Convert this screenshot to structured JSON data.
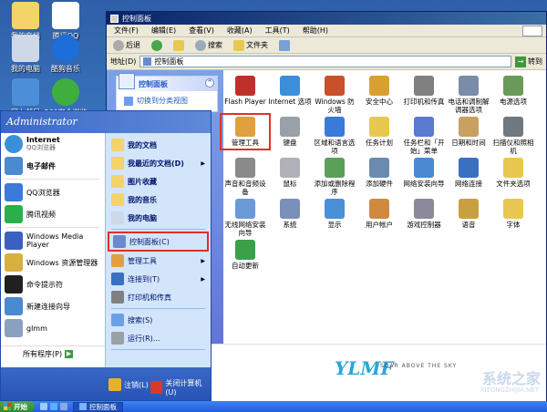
{
  "desktop": {
    "icons": [
      {
        "label": "我的文档",
        "color": "#f3d36a"
      },
      {
        "label": "腾讯QQ",
        "color": "#ffffff"
      },
      {
        "label": "我的电脑",
        "color": "#cfd8e8"
      },
      {
        "label": "酷狗音乐",
        "color": "#1d6ed8"
      },
      {
        "label": "网上邻居",
        "color": "#4c8ed8"
      },
      {
        "label": "360安全浏览",
        "color": "#3fae3f"
      }
    ]
  },
  "window": {
    "title": "控制面板",
    "menu": [
      "文件(F)",
      "编辑(E)",
      "查看(V)",
      "收藏(A)",
      "工具(T)",
      "帮助(H)"
    ],
    "toolbar": {
      "back": "后退",
      "search": "搜索",
      "folders": "文件夹"
    },
    "address": {
      "label": "地址(D)",
      "value": "控制面板",
      "go": "转到"
    },
    "task_panel": {
      "title": "控制面板",
      "link": "切换到分类视图"
    },
    "items": [
      {
        "label": "Flash Player",
        "color": "#c0302a"
      },
      {
        "label": "Internet 选项",
        "color": "#3a8fd8"
      },
      {
        "label": "Windows 防火墙",
        "color": "#c8502a"
      },
      {
        "label": "安全中心",
        "color": "#d8a030"
      },
      {
        "label": "打印机和传真",
        "color": "#808080"
      },
      {
        "label": "电话和调制解调器选项",
        "color": "#7a8da8"
      },
      {
        "label": "电源选项",
        "color": "#6a9a5a"
      },
      {
        "label": "管理工具",
        "color": "#e0a040"
      },
      {
        "label": "键盘",
        "color": "#9aa0a8"
      },
      {
        "label": "区域和语言选项",
        "color": "#3a7ad8"
      },
      {
        "label": "任务计划",
        "color": "#e8c850"
      },
      {
        "label": "任务栏和「开始」菜单",
        "color": "#5a7ad0"
      },
      {
        "label": "日期和时间",
        "color": "#c8a060"
      },
      {
        "label": "扫描仪和照相机",
        "color": "#707880"
      },
      {
        "label": "声音和音频设备",
        "color": "#8a8a8a"
      },
      {
        "label": "鼠标",
        "color": "#b0b0b8"
      },
      {
        "label": "添加或删除程序",
        "color": "#5aa05a"
      },
      {
        "label": "添加硬件",
        "color": "#6a8ab0"
      },
      {
        "label": "网络安装向导",
        "color": "#4a8ad0"
      },
      {
        "label": "网络连接",
        "color": "#3a70c0"
      },
      {
        "label": "文件夹选项",
        "color": "#e8c850"
      },
      {
        "label": "无线网络安装向导",
        "color": "#6a9ad8"
      },
      {
        "label": "系统",
        "color": "#7a90b8"
      },
      {
        "label": "显示",
        "color": "#4a90d8"
      },
      {
        "label": "用户帐户",
        "color": "#d08a40"
      },
      {
        "label": "游戏控制器",
        "color": "#8a8a9a"
      },
      {
        "label": "语音",
        "color": "#c8a040"
      },
      {
        "label": "字体",
        "color": "#e8c850"
      },
      {
        "label": "自动更新",
        "color": "#3aa04a"
      }
    ],
    "banner": {
      "logo": "YLMF",
      "tagline": "SOAR ABOVE THE SKY",
      "watermark": "系统之家",
      "watermark_url": "XITONGZHIJIA.NET"
    }
  },
  "start_menu": {
    "user": "Administrator",
    "left_pinned": [
      {
        "title": "Internet",
        "sub": "QQ浏览器",
        "color": "#3a8fd8"
      },
      {
        "title": "电子邮件",
        "sub": "",
        "color": "#4a8ad0"
      }
    ],
    "left_recent": [
      {
        "title": "QQ浏览器",
        "color": "#3a7ad8"
      },
      {
        "title": "腾讯视频",
        "color": "#2ab04a"
      },
      {
        "title": "Windows Media Player",
        "color": "#3a60c0"
      },
      {
        "title": "Windows 资源管理器",
        "color": "#d8b040"
      },
      {
        "title": "命令提示符",
        "color": "#202020"
      },
      {
        "title": "新建连接向导",
        "color": "#4a8ad0"
      },
      {
        "title": "glmm",
        "color": "#8aa0c0"
      }
    ],
    "all_programs": "所有程序(P)",
    "right": [
      {
        "label": "我的文档",
        "bold": true,
        "arrow": false,
        "color": "#f3d36a"
      },
      {
        "label": "我最近的文档(D)",
        "bold": true,
        "arrow": true,
        "color": "#f3d36a"
      },
      {
        "label": "图片收藏",
        "bold": true,
        "arrow": false,
        "color": "#f3d36a"
      },
      {
        "label": "我的音乐",
        "bold": true,
        "arrow": false,
        "color": "#f3d36a"
      },
      {
        "label": "我的电脑",
        "bold": true,
        "arrow": false,
        "color": "#cfd8e8"
      }
    ],
    "right2": [
      {
        "label": "控制面板(C)",
        "highlight": true,
        "arrow": false,
        "color": "#6a8ad0"
      },
      {
        "label": "管理工具",
        "highlight": false,
        "arrow": true,
        "color": "#e0a040"
      },
      {
        "label": "连接到(T)",
        "highlight": false,
        "arrow": true,
        "color": "#3a70c0"
      },
      {
        "label": "打印机和传真",
        "highlight": false,
        "arrow": false,
        "color": "#808080"
      }
    ],
    "right3": [
      {
        "label": "搜索(S)",
        "color": "#6aa0e8"
      },
      {
        "label": "运行(R)...",
        "color": "#9aa0a8"
      }
    ],
    "logoff": "注销(L)",
    "shutdown": "关闭计算机(U)"
  },
  "taskbar": {
    "start": "开始",
    "task": "控制面板"
  }
}
